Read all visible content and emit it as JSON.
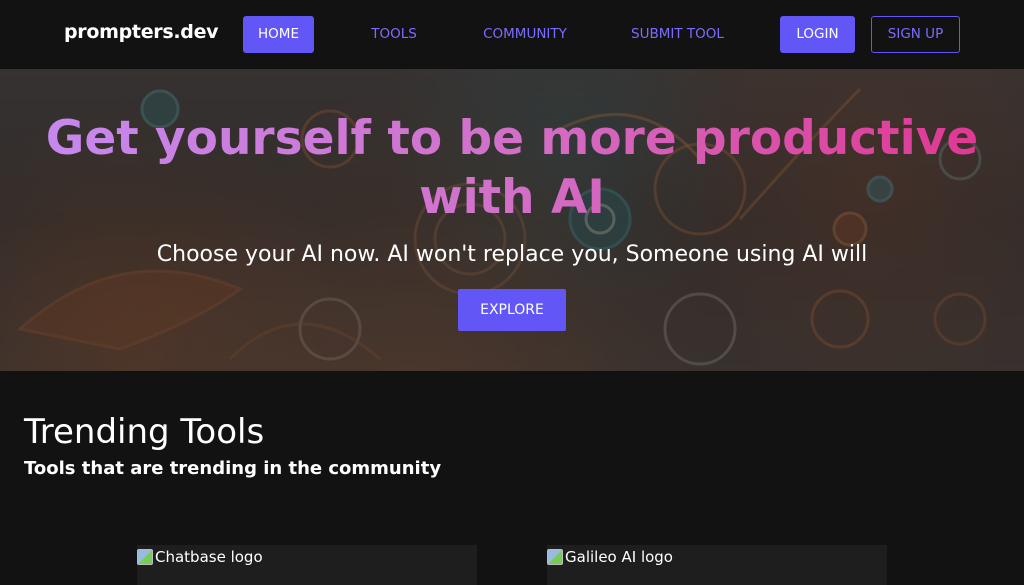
{
  "navbar": {
    "brand": "prompters.dev",
    "links": [
      {
        "label": "HOME",
        "active": true
      },
      {
        "label": "TOOLS",
        "active": false
      },
      {
        "label": "COMMUNITY",
        "active": false
      },
      {
        "label": "SUBMIT TOOL",
        "active": false
      }
    ],
    "login_label": "LOGIN",
    "signup_label": "SIGN UP"
  },
  "hero": {
    "title": "Get yourself to be more productive with AI",
    "subtitle": "Choose your AI now. AI won't replace you, Someone using AI will",
    "cta_label": "EXPLORE"
  },
  "trending": {
    "title": "Trending Tools",
    "subtitle": "Tools that are trending in the community",
    "cards": [
      {
        "logo_alt": "Chatbase logo"
      },
      {
        "logo_alt": "Galileo AI logo"
      }
    ]
  },
  "colors": {
    "accent": "#6257f6",
    "accent_text": "#7b6cff",
    "background": "#121212",
    "title_gradient": [
      "#c58af0",
      "#e0358f"
    ]
  }
}
